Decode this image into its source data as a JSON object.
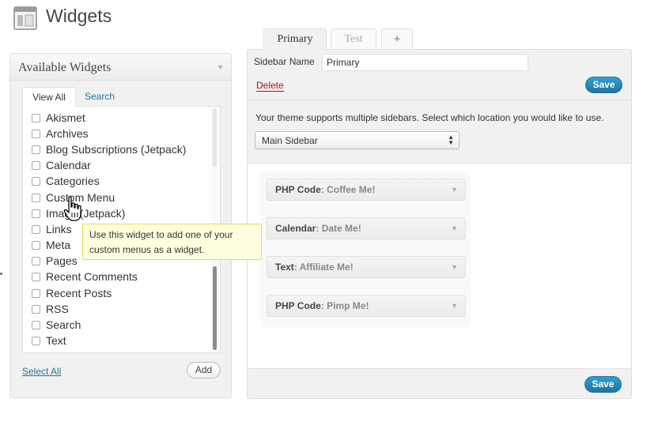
{
  "header": {
    "title": "Widgets",
    "icon": "widgets-page-icon"
  },
  "available": {
    "title": "Available Widgets",
    "tabs": {
      "view_all": "View All",
      "search": "Search"
    },
    "items": [
      "Akismet",
      "Archives",
      "Blog Subscriptions (Jetpack)",
      "Calendar",
      "Categories",
      "Custom Menu",
      "Image (Jetpack)",
      "Links",
      "Meta",
      "Pages",
      "Recent Comments",
      "Recent Posts",
      "RSS",
      "Search",
      "Text"
    ],
    "select_all": "Select All",
    "add": "Add"
  },
  "tooltip": {
    "text": "Use this widget to add one of your custom menus as a widget."
  },
  "sidebar_tabs": [
    "Primary",
    "Test",
    "+"
  ],
  "sidebar": {
    "name_label": "Sidebar Name",
    "name_value": "Primary",
    "delete": "Delete",
    "save": "Save",
    "location_text": "Your theme supports multiple sidebars.  Select which location you would like to use.",
    "location_selected": "Main Sidebar",
    "widgets": [
      {
        "name": "PHP Code",
        "title": ": Coffee Me!"
      },
      {
        "name": "Calendar",
        "title": ": Date Me!"
      },
      {
        "name": "Text",
        "title": ": Affiliate Me!"
      },
      {
        "name": "PHP Code",
        "title": ": Pimp Me!"
      }
    ]
  },
  "colors": {
    "link": "#21759b",
    "delete": "#bc0b0b",
    "save_bg": "#21759b",
    "tooltip_bg": "#ffffe0"
  }
}
